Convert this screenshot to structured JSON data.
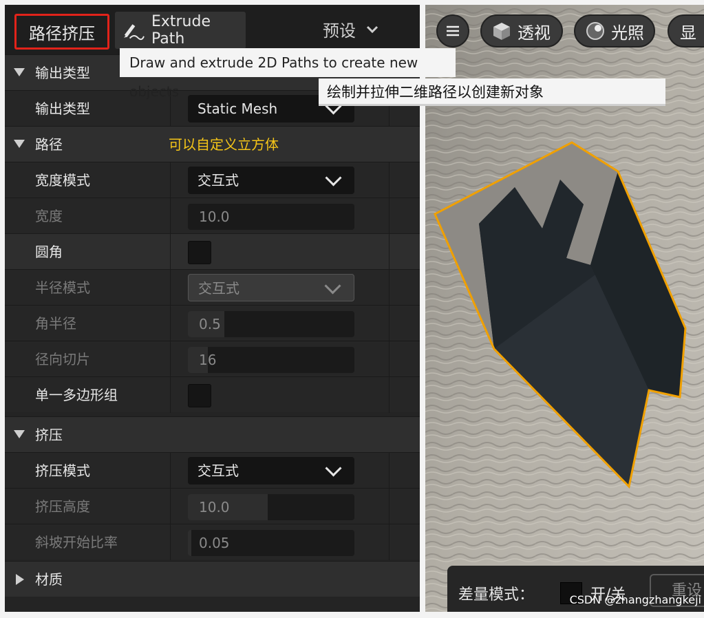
{
  "header": {
    "mode_title": "路径挤压",
    "tool_button": "Extrude Path",
    "preset_label": "预设"
  },
  "tooltips": {
    "english": "Draw and extrude 2D Paths to create new objects",
    "chinese": "绘制并拉伸二维路径以创建新对象"
  },
  "sections": {
    "output_type": "输出类型",
    "path": "路径",
    "path_note": "可以自定义立方体",
    "extrude": "挤压",
    "material": "材质"
  },
  "properties": {
    "output_type": {
      "label": "输出类型",
      "value": "Static Mesh"
    },
    "width_mode": {
      "label": "宽度模式",
      "value": "交互式"
    },
    "width": {
      "label": "宽度",
      "value": "10.0",
      "fill": 0
    },
    "rounded": {
      "label": "圆角"
    },
    "radius_mode": {
      "label": "半径模式",
      "value": "交互式"
    },
    "corner_radius": {
      "label": "角半径",
      "value": "0.5",
      "fill": 0.22
    },
    "radial_slices": {
      "label": "径向切片",
      "value": "16",
      "fill": 0.12
    },
    "single_polygroup": {
      "label": "单一多边形组"
    },
    "extrude_mode": {
      "label": "挤压模式",
      "value": "交互式"
    },
    "extrude_height": {
      "label": "挤压高度",
      "value": "10.0",
      "fill": 0.48
    },
    "ramp_start_ratio": {
      "label": "斜坡开始比率",
      "value": "0.05",
      "fill": 0.02
    }
  },
  "viewport": {
    "menu_icon": "hamburger-icon",
    "perspective": "透视",
    "lighting": "光照",
    "show": "显",
    "diff_mode_label": "差量模式：",
    "diff_toggle_label": "开/关",
    "reset_label": "重设"
  },
  "watermark": "CSDN @zhangzhangkeji",
  "colors": {
    "highlight_border": "#e2231a",
    "note_text": "#f5c518",
    "selection_outline": "#f0a000"
  }
}
